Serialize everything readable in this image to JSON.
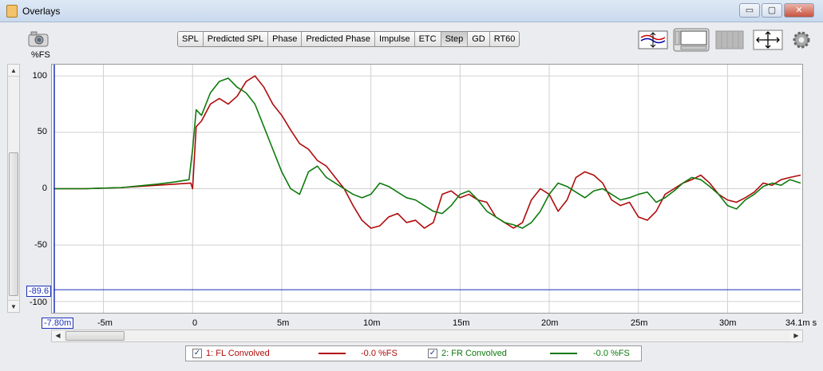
{
  "window": {
    "title": "Overlays",
    "minimize": "▭",
    "maximize": "▢",
    "close": "✕"
  },
  "toolbar": {
    "units_label": "%FS",
    "tabs": [
      {
        "label": "SPL",
        "active": false
      },
      {
        "label": "Predicted SPL",
        "active": false
      },
      {
        "label": "Phase",
        "active": false
      },
      {
        "label": "Predicted Phase",
        "active": false
      },
      {
        "label": "Impulse",
        "active": false
      },
      {
        "label": "ETC",
        "active": false
      },
      {
        "label": "Step",
        "active": true
      },
      {
        "label": "GD",
        "active": false
      },
      {
        "label": "RT60",
        "active": false
      }
    ],
    "icons": [
      "camera-icon",
      "overlay-controls-icon",
      "graph-layout-icon",
      "grid-pattern-icon",
      "fit-arrows-icon",
      "gear-icon"
    ]
  },
  "plot": {
    "y_cursor_label": "-89.6",
    "x_cursor_label": "-7.80m",
    "x_unit_end": "34.1m s"
  },
  "legend": {
    "entries": [
      {
        "label": "1: FL Convolved",
        "value": "-0.0 %FS",
        "color": "#b00a0a",
        "checked": true
      },
      {
        "label": "2: FR Convolved",
        "value": "-0.0 %FS",
        "color": "#0c7a0c",
        "checked": true
      }
    ]
  },
  "chart_data": {
    "type": "line",
    "ylabel": "%FS",
    "x_tick_labels": [
      "-5m",
      "0",
      "5m",
      "10m",
      "15m",
      "20m",
      "25m",
      "30m"
    ],
    "y_tick_labels": [
      "100",
      "50",
      "0",
      "-50",
      "-100"
    ],
    "xlim": [
      -7.8,
      34.1
    ],
    "ylim": [
      -110,
      110
    ],
    "grid": true,
    "cursors": {
      "x": -7.8,
      "y": -89.6
    },
    "series": [
      {
        "name": "1: FL Convolved",
        "color": "#b00a0a",
        "x": [
          -7.8,
          -6,
          -4,
          -2,
          -1,
          -0.1,
          0,
          0.2,
          0.5,
          1,
          1.5,
          2,
          2.5,
          3,
          3.5,
          4,
          4.5,
          5,
          5.5,
          6,
          6.5,
          7,
          7.5,
          8,
          8.5,
          9,
          9.5,
          10,
          10.5,
          11,
          11.5,
          12,
          12.5,
          13,
          13.5,
          14,
          14.5,
          15,
          15.5,
          16,
          16.5,
          17,
          17.5,
          18,
          18.5,
          19,
          19.5,
          20,
          20.5,
          21,
          21.5,
          22,
          22.5,
          23,
          23.5,
          24,
          24.5,
          25,
          25.5,
          26,
          26.5,
          27,
          27.5,
          28,
          28.5,
          29,
          29.5,
          30,
          30.5,
          31,
          31.5,
          32,
          32.5,
          33,
          33.5,
          34.1
        ],
        "y": [
          0,
          0,
          1,
          3,
          4,
          5,
          0,
          55,
          60,
          75,
          80,
          75,
          82,
          95,
          100,
          90,
          75,
          65,
          52,
          40,
          35,
          25,
          20,
          10,
          0,
          -15,
          -28,
          -35,
          -33,
          -25,
          -22,
          -30,
          -28,
          -35,
          -30,
          -5,
          -2,
          -8,
          -5,
          -10,
          -12,
          -25,
          -30,
          -35,
          -30,
          -10,
          0,
          -5,
          -20,
          -10,
          10,
          15,
          12,
          5,
          -10,
          -15,
          -12,
          -25,
          -28,
          -20,
          -5,
          0,
          5,
          8,
          12,
          5,
          -5,
          -10,
          -12,
          -8,
          -3,
          5,
          3,
          8,
          10,
          12
        ]
      },
      {
        "name": "2: FR Convolved",
        "color": "#0c7a0c",
        "x": [
          -7.8,
          -6,
          -4,
          -2,
          -1,
          -0.2,
          0,
          0.2,
          0.5,
          1,
          1.5,
          2,
          2.5,
          3,
          3.5,
          4,
          4.5,
          5,
          5.5,
          6,
          6.5,
          7,
          7.5,
          8,
          8.5,
          9,
          9.5,
          10,
          10.5,
          11,
          11.5,
          12,
          12.5,
          13,
          13.5,
          14,
          14.5,
          15,
          15.5,
          16,
          16.5,
          17,
          17.5,
          18,
          18.5,
          19,
          19.5,
          20,
          20.5,
          21,
          21.5,
          22,
          22.5,
          23,
          23.5,
          24,
          24.5,
          25,
          25.5,
          26,
          26.5,
          27,
          27.5,
          28,
          28.5,
          29,
          29.5,
          30,
          30.5,
          31,
          31.5,
          32,
          32.5,
          33,
          33.5,
          34.1
        ],
        "y": [
          0,
          0,
          1,
          4,
          6,
          8,
          35,
          70,
          65,
          85,
          95,
          98,
          90,
          85,
          75,
          55,
          35,
          15,
          0,
          -5,
          15,
          20,
          10,
          5,
          0,
          -5,
          -8,
          -5,
          5,
          2,
          -3,
          -8,
          -10,
          -15,
          -20,
          -22,
          -15,
          -5,
          -2,
          -10,
          -20,
          -25,
          -30,
          -32,
          -35,
          -30,
          -20,
          -5,
          5,
          2,
          -3,
          -8,
          -2,
          0,
          -5,
          -10,
          -8,
          -5,
          -3,
          -12,
          -8,
          -2,
          5,
          10,
          8,
          2,
          -5,
          -15,
          -18,
          -10,
          -5,
          2,
          5,
          3,
          8,
          5
        ]
      }
    ]
  }
}
